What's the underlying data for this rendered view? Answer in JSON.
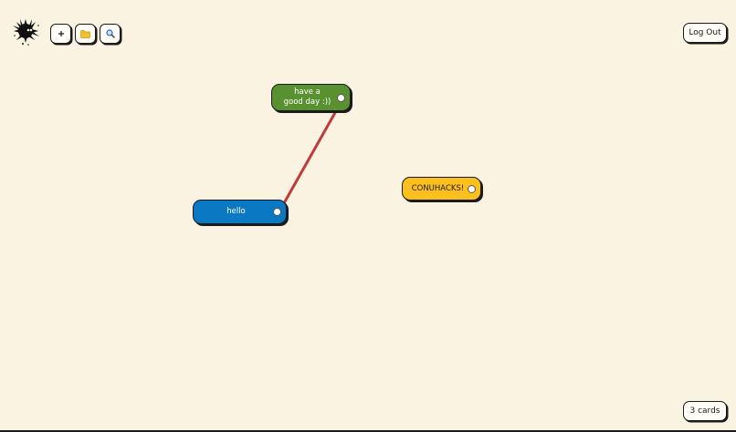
{
  "app": {
    "logo_icon": "ink-splat-logo-icon"
  },
  "toolbar": {
    "buttons": [
      {
        "icon": "plus-icon",
        "label": "+"
      },
      {
        "icon": "folder-icon",
        "label": "📁"
      },
      {
        "icon": "search-icon",
        "label": "🔍"
      }
    ]
  },
  "header": {
    "logout_label": "Log Out"
  },
  "canvas": {
    "cards": [
      {
        "text": "have a good day :))",
        "color": "#5a9130",
        "text_color": "#ffffff"
      },
      {
        "text": "hello",
        "color": "#0a78c2",
        "text_color": "#ffffff"
      },
      {
        "text": "CONUHACKS!",
        "color": "#fcc01e",
        "text_color": "#1b1b1b"
      }
    ],
    "connection_color": "#c23a3a"
  },
  "footer": {
    "card_count_label": "3 cards"
  }
}
